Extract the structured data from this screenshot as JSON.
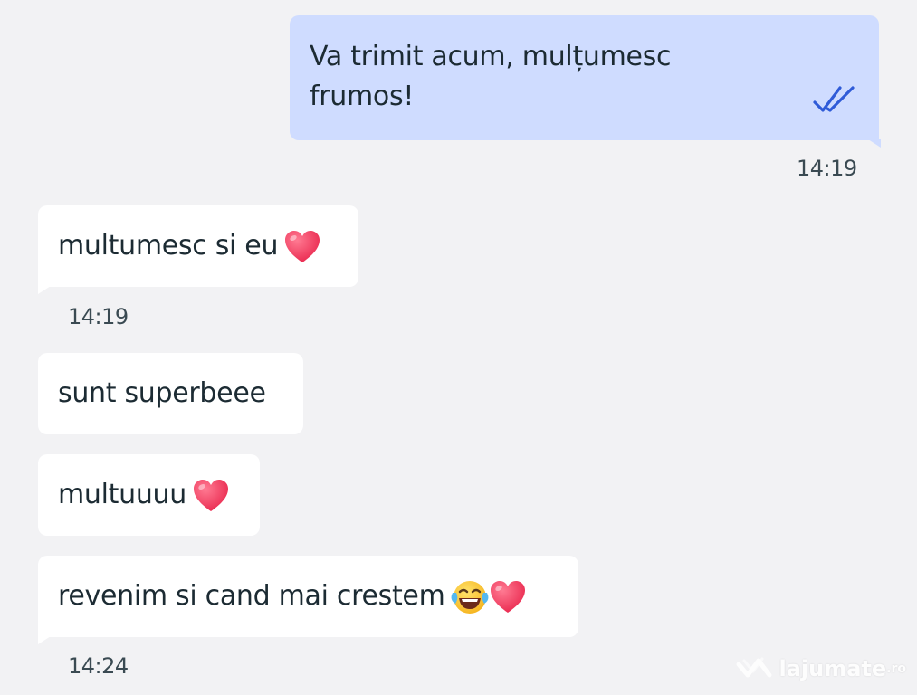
{
  "messages": [
    {
      "direction": "outgoing",
      "text_line1": "Va trimit acum, mulțumesc",
      "text_line2": "frumos!",
      "status": "read-double-check-icon",
      "time": "14:19"
    },
    {
      "direction": "incoming",
      "text": "multumesc si eu",
      "emoji": "red-heart-icon",
      "time": "14:19"
    },
    {
      "direction": "incoming",
      "text": "sunt superbeee"
    },
    {
      "direction": "incoming",
      "text": "multuuuu",
      "emoji": "red-heart-icon"
    },
    {
      "direction": "incoming",
      "text": "revenim si cand mai crestem",
      "emoji": [
        "tears-of-joy-icon",
        "red-heart-icon"
      ],
      "time": "14:24"
    }
  ],
  "watermark": {
    "name": "lajumate",
    "suffix": ".ro"
  },
  "colors": {
    "background": "#f2f2f4",
    "outgoing_bubble": "#cfdcff",
    "incoming_bubble": "#ffffff",
    "check_marks": "#2f5bd8",
    "text": "#1c2b33",
    "heart": "#f0375a"
  }
}
